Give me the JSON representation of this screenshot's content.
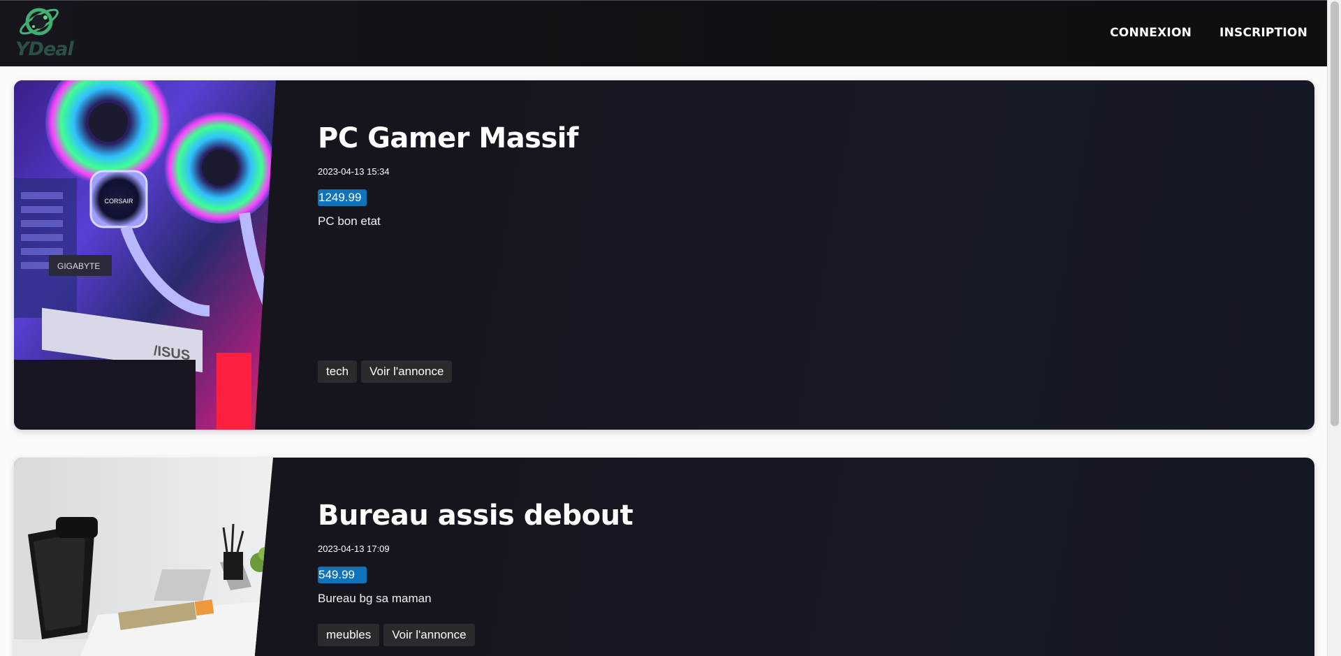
{
  "header": {
    "logo_text": "YDeal",
    "nav": [
      {
        "label": "CONNEXION"
      },
      {
        "label": "INSCRIPTION"
      }
    ]
  },
  "listings": [
    {
      "title": "PC Gamer Massif",
      "date": "2023-04-13 15:34",
      "price": "1249.99",
      "description": "PC bon etat",
      "category": "tech",
      "cta": "Voir l'annonce",
      "image_alt": "rgb-gaming-pc-interior"
    },
    {
      "title": "Bureau assis debout",
      "date": "2023-04-13 17:09",
      "price": "549.99",
      "description": "Bureau bg sa maman",
      "category": "meubles",
      "cta": "Voir l'annonce",
      "image_alt": "office-desk-with-chair"
    }
  ],
  "colors": {
    "header_bg": "#111116",
    "card_bg": "#16151e",
    "price_badge": "#0e73ba",
    "tag_bg": "#2a2a2f",
    "logo_green": "#3aa86a"
  }
}
